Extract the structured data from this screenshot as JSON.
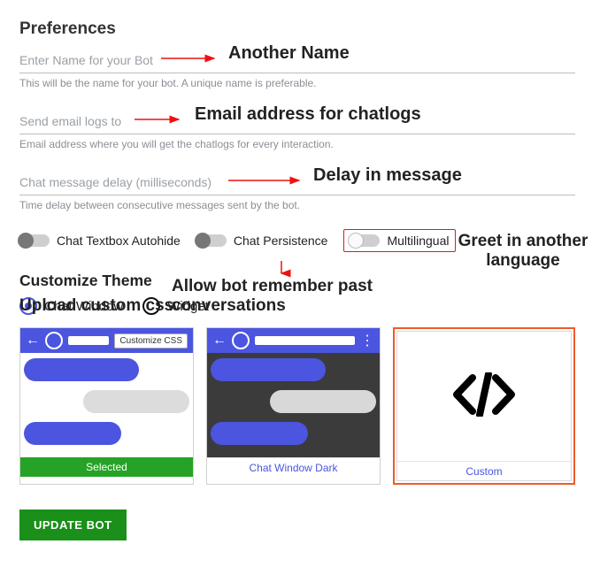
{
  "header": {
    "title": "Preferences"
  },
  "fields": {
    "name": {
      "placeholder": "Enter Name for your Bot",
      "helper": "This will be the name for your bot. A unique name is preferable."
    },
    "email": {
      "placeholder": "Send email logs to",
      "helper": "Email address where you will get the chatlogs for every interaction."
    },
    "delay": {
      "placeholder": "Chat message delay (milliseconds)",
      "helper": "Time delay between consecutive messages sent by the bot."
    }
  },
  "toggles": {
    "autohide": "Chat Textbox Autohide",
    "persistence": "Chat Persistence",
    "multilingual": "Multilingual"
  },
  "theme": {
    "heading": "Customize Theme",
    "radio_chat": "Chat Window",
    "radio_widget": "Widget",
    "customize_css": "Customize CSS",
    "caption_selected": "Selected",
    "caption_dark": "Chat Window Dark",
    "caption_custom": "Custom"
  },
  "annotations": {
    "name": "Another Name",
    "email": "Email address for chatlogs",
    "delay": "Delay in message",
    "greet": "Greet in another language",
    "remember": "Allow bot remember past conversations",
    "upload": "Upload custom css"
  },
  "button": {
    "update": "UPDATE BOT"
  }
}
